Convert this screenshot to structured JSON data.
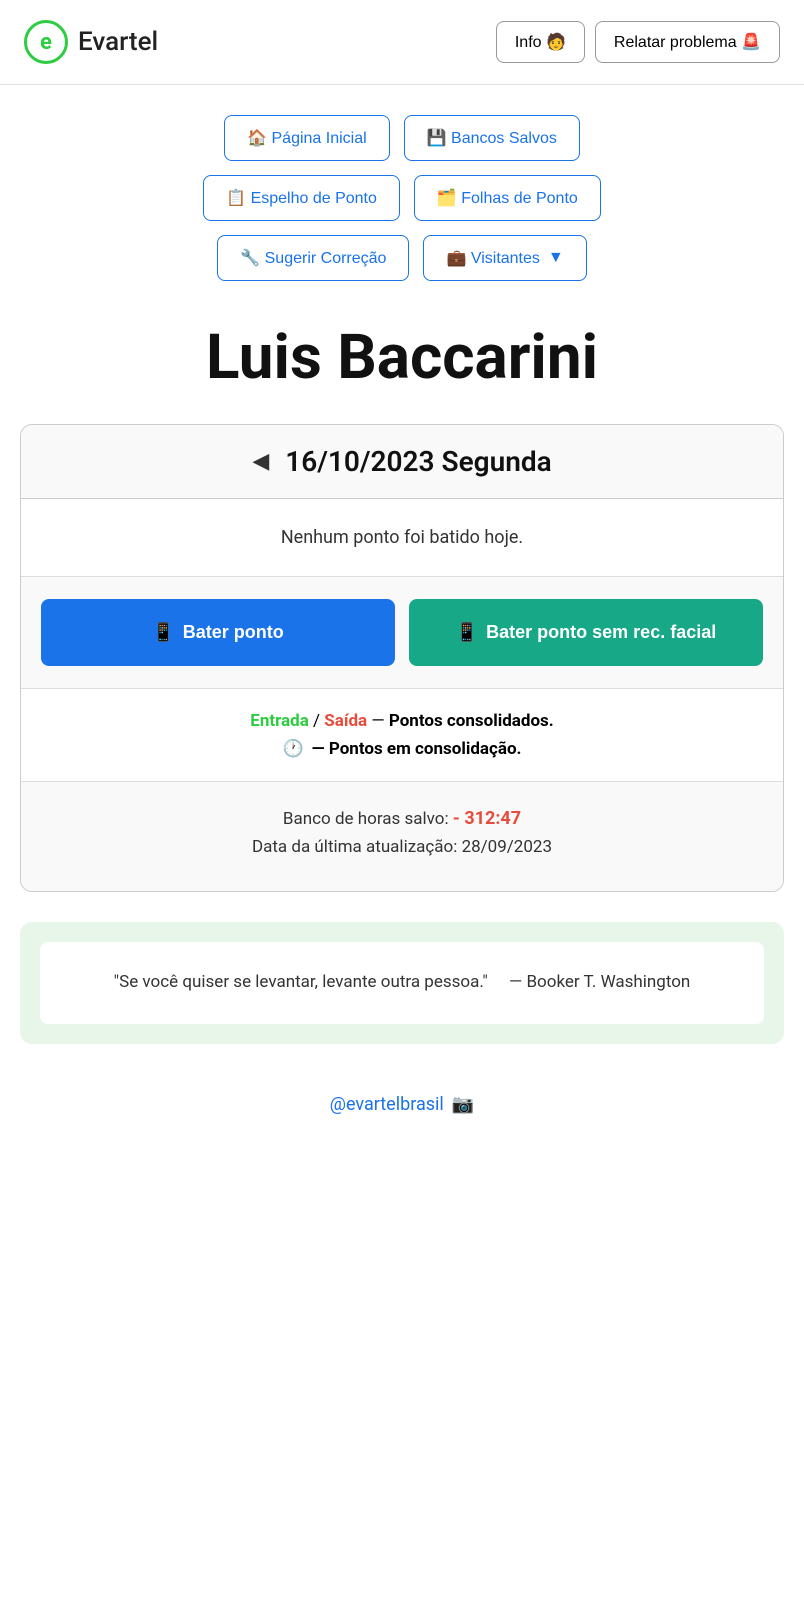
{
  "header": {
    "logo_letter": "e",
    "app_name": "Evartel",
    "info_button": "Info 🧑",
    "report_button": "Relatar problema 🚨"
  },
  "nav": {
    "pagina_inicial": "🏠 Página Inicial",
    "bancos_salvos": "💾 Bancos Salvos",
    "espelho_de_ponto": "📋 Espelho de Ponto",
    "folhas_de_ponto": "🗂️ Folhas de Ponto",
    "sugerir_correcao": "🔧 Sugerir Correção",
    "visitantes": "💼 Visitantes",
    "visitantes_arrow": "▼"
  },
  "user": {
    "name": "Luis Baccarini"
  },
  "date_card": {
    "arrow_left": "◀",
    "date_text": "16/10/2023 Segunda",
    "no_punch_msg": "Nenhum ponto foi batido hoje.",
    "btn_bater": "Bater ponto",
    "btn_bater_icon": "📱",
    "btn_bater_sem": "Bater ponto sem rec. facial",
    "btn_bater_sem_icon": "📱",
    "legend_entrada": "Entrada",
    "legend_slash": " / ",
    "legend_saida": "Saída",
    "legend_dash": " — ",
    "legend_consolidated": "Pontos consolidados.",
    "legend_clock_icon": "🕐",
    "legend_consolidating": "— Pontos em consolidação.",
    "banco_label": "Banco de horas salvo: ",
    "banco_value": "- 312:47",
    "atualizacao_label": "Data da última atualização: ",
    "atualizacao_value": "28/09/2023"
  },
  "quote": {
    "text": "\"Se você quiser se levantar, levante outra pessoa.\"",
    "author": "— Booker T. Washington"
  },
  "footer": {
    "instagram": "@evartelbrasil",
    "instagram_icon": "📷"
  }
}
